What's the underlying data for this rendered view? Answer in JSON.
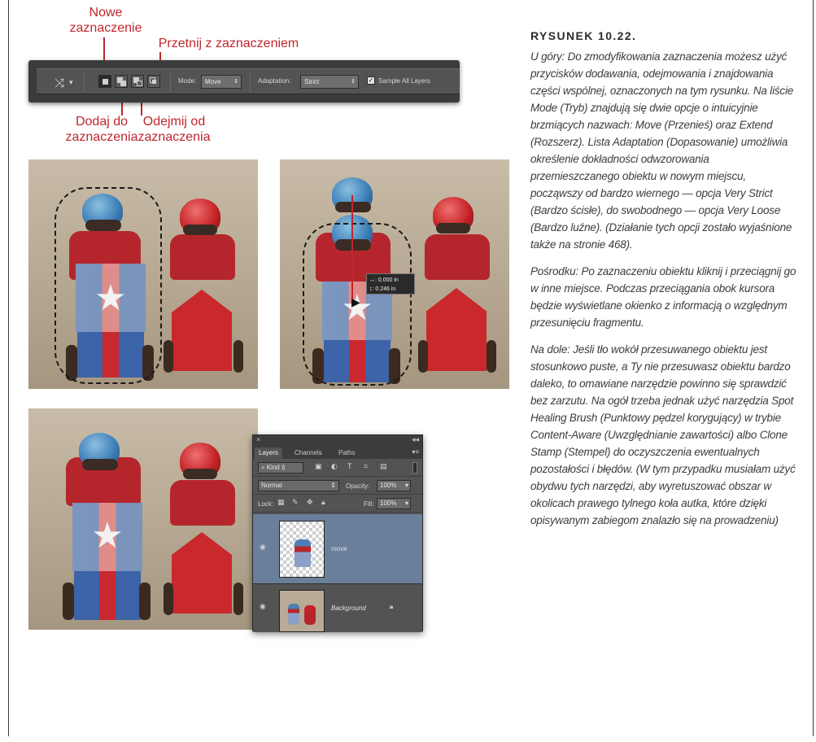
{
  "figure": {
    "title": "RYSUNEK 10.22.",
    "paragraphs": [
      "U góry: Do zmodyfikowania zaznaczenia możesz użyć przycisków dodawania, odejmowania i znajdowania części wspólnej, oznaczonych na tym rysunku. Na liście Mode (Tryb) znajdują się dwie opcje o intuicyjnie brzmiących nazwach: Move (Przenieś) oraz Extend (Rozszerz). Lista Adaptation (Dopasowanie) umożliwia określenie dokładności odwzorowania przemieszczanego obiektu w nowym miejscu, począwszy od bardzo wiernego — opcja Very Strict (Bardzo ścisłe), do swobodnego — opcja Very Loose (Bardzo luźne). (Działanie tych opcji zostało wyjaśnione także na stronie 468).",
      "Pośrodku: Po zaznaczeniu obiektu kliknij i przeciągnij go w inne miejsce. Podczas przeciągania obok kursora będzie wyświetlane okienko z informacją o względnym przesunięciu fragmentu.",
      "Na dole: Jeśli tło wokół przesuwanego obiektu jest stosunkowo puste, a Ty nie przesuwasz obiektu bardzo daleko, to omawiane narzędzie powinno się sprawdzić bez zarzutu. Na ogół trzeba jednak użyć narzędzia Spot Healing Brush (Punktowy pędzel korygujący) w trybie Content-Aware (Uwzględnianie zawartości) albo Clone Stamp (Stempel) do oczyszczenia ewentualnych pozostałości i błędów. (W tym przypadku musiałam użyć obydwu tych narzędzi, aby wyretuszować obszar w okolicach prawego tylnego koła autka, które dzięki opisywanym zabiegom znalazło się na prowadzeniu)"
    ]
  },
  "callouts": {
    "new_selection": [
      "Nowe",
      "zaznaczenie"
    ],
    "intersect": "Przetnij z zaznaczeniem",
    "add": [
      "Dodaj do",
      "zaznaczenia"
    ],
    "subtract": [
      "Odejmij od",
      "zaznaczenia"
    ]
  },
  "options_bar": {
    "mode_label": "Mode:",
    "mode_value": "Move",
    "adaptation_label": "Adaptation:",
    "adaptation_value": "Strict",
    "sample_label": "Sample All Layers",
    "sample_checked": true
  },
  "move_readout": {
    "dx": "↔: 0.000 in",
    "dy": "↕: 0.246 in"
  },
  "layers_panel": {
    "close": "×",
    "collapse": "◂◂",
    "tabs": [
      "Layers",
      "Channels",
      "Paths"
    ],
    "filter_label": "Kind",
    "blend_mode": "Normal",
    "opacity_label": "Opacity:",
    "opacity_value": "100%",
    "lock_label": "Lock:",
    "fill_label": "Fill:",
    "fill_value": "100%",
    "layers": [
      {
        "name": "move",
        "selected": true
      },
      {
        "name": "Background",
        "selected": false
      }
    ]
  },
  "colors": {
    "callout": "#c0262d",
    "body_text": "#3c3c3c"
  }
}
